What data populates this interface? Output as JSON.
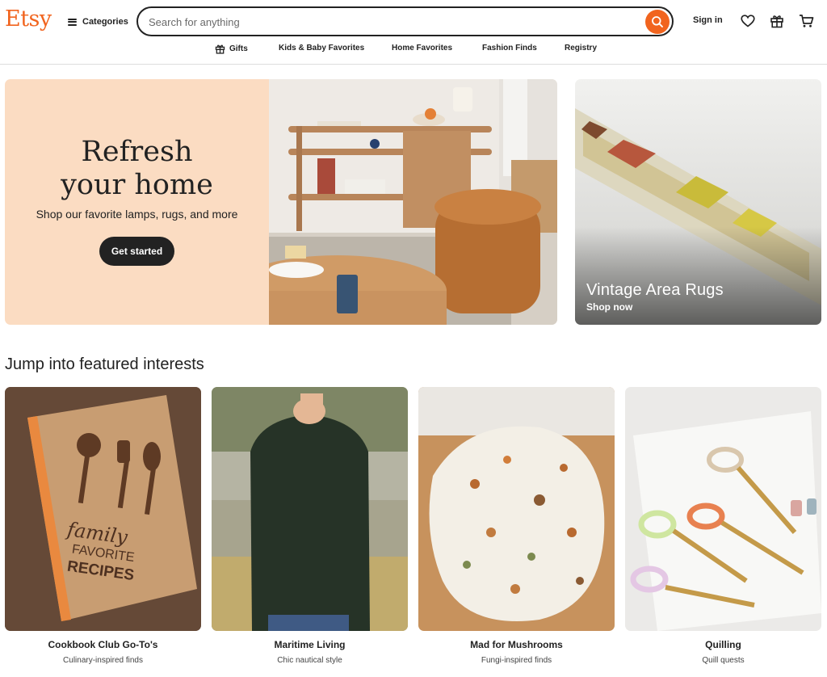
{
  "header": {
    "logo": "Etsy",
    "categories_label": "Categories",
    "search_placeholder": "Search for anything",
    "sign_in": "Sign in"
  },
  "nav": {
    "items": [
      "Gifts",
      "Kids & Baby Favorites",
      "Home Favorites",
      "Fashion Finds",
      "Registry"
    ]
  },
  "hero": {
    "title_line1": "Refresh",
    "title_line2": "your home",
    "subtitle": "Shop our favorite lamps, rugs, and more",
    "cta": "Get started"
  },
  "promo": {
    "title": "Vintage Area Rugs",
    "subtitle": "Shop now"
  },
  "featured": {
    "heading": "Jump into featured interests",
    "cards": [
      {
        "title": "Cookbook Club Go-To's",
        "subtitle": "Culinary-inspired finds",
        "image_text": [
          "family",
          "FAVORITE",
          "RECIPES"
        ]
      },
      {
        "title": "Maritime Living",
        "subtitle": "Chic nautical style"
      },
      {
        "title": "Mad for Mushrooms",
        "subtitle": "Fungi-inspired finds"
      },
      {
        "title": "Quilling",
        "subtitle": "Quill quests"
      }
    ]
  },
  "colors": {
    "brand": "#f1641e",
    "hero_bg": "#fbdcc2",
    "text": "#222222"
  },
  "icons": [
    "hamburger-icon",
    "search-icon",
    "heart-icon",
    "gift-icon",
    "cart-icon"
  ]
}
